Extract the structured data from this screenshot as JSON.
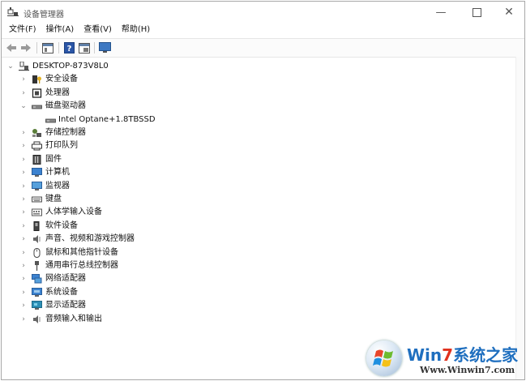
{
  "window": {
    "title": "设备管理器"
  },
  "menubar": [
    "文件(F)",
    "操作(A)",
    "查看(V)",
    "帮助(H)"
  ],
  "toolbar": [
    "back-icon",
    "forward-icon",
    "properties-icon",
    "help-icon",
    "view-icon",
    "monitor-icon"
  ],
  "tree": {
    "root": "DESKTOP-873V8L0",
    "items": [
      {
        "label": "安全设备",
        "icon": "security-device-icon",
        "expanded": false
      },
      {
        "label": "处理器",
        "icon": "processor-icon",
        "expanded": false
      },
      {
        "label": "磁盘驱动器",
        "icon": "disk-drive-icon",
        "expanded": true,
        "children": [
          {
            "label": "Intel Optane+1.8TBSSD",
            "icon": "disk-icon"
          }
        ]
      },
      {
        "label": "存储控制器",
        "icon": "storage-controller-icon",
        "expanded": false
      },
      {
        "label": "打印队列",
        "icon": "printer-icon",
        "expanded": false
      },
      {
        "label": "固件",
        "icon": "firmware-icon",
        "expanded": false
      },
      {
        "label": "计算机",
        "icon": "computer-icon",
        "expanded": false
      },
      {
        "label": "监视器",
        "icon": "monitor-icon",
        "expanded": false
      },
      {
        "label": "键盘",
        "icon": "keyboard-icon",
        "expanded": false
      },
      {
        "label": "人体学输入设备",
        "icon": "hid-icon",
        "expanded": false
      },
      {
        "label": "软件设备",
        "icon": "software-device-icon",
        "expanded": false
      },
      {
        "label": "声音、视频和游戏控制器",
        "icon": "sound-icon",
        "expanded": false
      },
      {
        "label": "鼠标和其他指针设备",
        "icon": "mouse-icon",
        "expanded": false
      },
      {
        "label": "通用串行总线控制器",
        "icon": "usb-icon",
        "expanded": false
      },
      {
        "label": "网络适配器",
        "icon": "network-icon",
        "expanded": false
      },
      {
        "label": "系统设备",
        "icon": "system-device-icon",
        "expanded": false
      },
      {
        "label": "显示适配器",
        "icon": "display-adapter-icon",
        "expanded": false
      },
      {
        "label": "音频输入和输出",
        "icon": "audio-io-icon",
        "expanded": false
      }
    ]
  },
  "watermark": {
    "brand_prefix": "Win",
    "brand_seven": "7",
    "brand_suffix": "系统之家",
    "url": "Www.Winwin7.com"
  }
}
